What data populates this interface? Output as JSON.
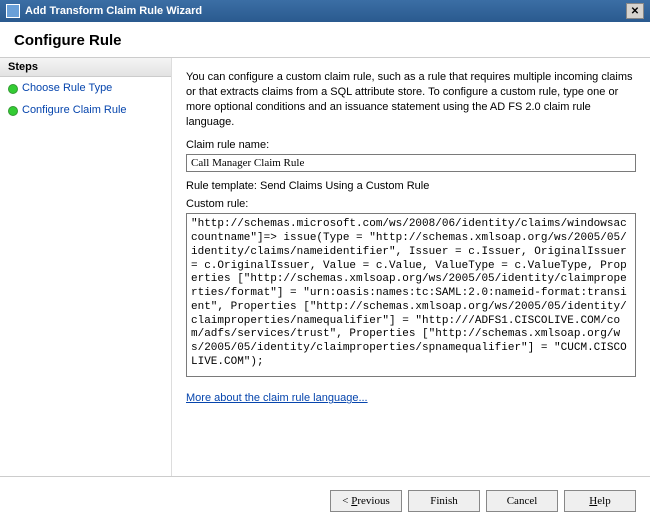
{
  "window": {
    "title": "Add Transform Claim Rule Wizard"
  },
  "header": {
    "title": "Configure Rule"
  },
  "sidebar": {
    "heading": "Steps",
    "items": [
      {
        "label": "Choose Rule Type"
      },
      {
        "label": "Configure Claim Rule"
      }
    ]
  },
  "main": {
    "intro": "You can configure a custom claim rule, such as a rule that requires multiple incoming claims or that extracts claims from a SQL attribute store. To configure a custom rule, type one or more optional conditions and an issuance statement using the AD FS 2.0 claim rule language.",
    "rule_name_label": "Claim rule name:",
    "rule_name_value": "Call Manager Claim Rule",
    "template_label": "Rule template: Send Claims Using a Custom Rule",
    "custom_rule_label": "Custom rule:",
    "custom_rule_value": "\"http://schemas.microsoft.com/ws/2008/06/identity/claims/windowsaccountname\"]=> issue(Type = \"http://schemas.xmlsoap.org/ws/2005/05/identity/claims/nameidentifier\", Issuer = c.Issuer, OriginalIssuer = c.OriginalIssuer, Value = c.Value, ValueType = c.ValueType, Properties [\"http://schemas.xmlsoap.org/ws/2005/05/identity/claimproperties/format\"] = \"urn:oasis:names:tc:SAML:2.0:nameid-format:transient\", Properties [\"http://schemas.xmlsoap.org/ws/2005/05/identity/claimproperties/namequalifier\"] = \"http:///ADFS1.CISCOLIVE.COM/com/adfs/services/trust\", Properties [\"http://schemas.xmlsoap.org/ws/2005/05/identity/claimproperties/spnamequalifier\"] = \"CUCM.CISCOLIVE.COM\");",
    "link": "More about the claim rule language..."
  },
  "footer": {
    "previous": "< Previous",
    "finish": "Finish",
    "cancel": "Cancel",
    "help": "Help"
  }
}
